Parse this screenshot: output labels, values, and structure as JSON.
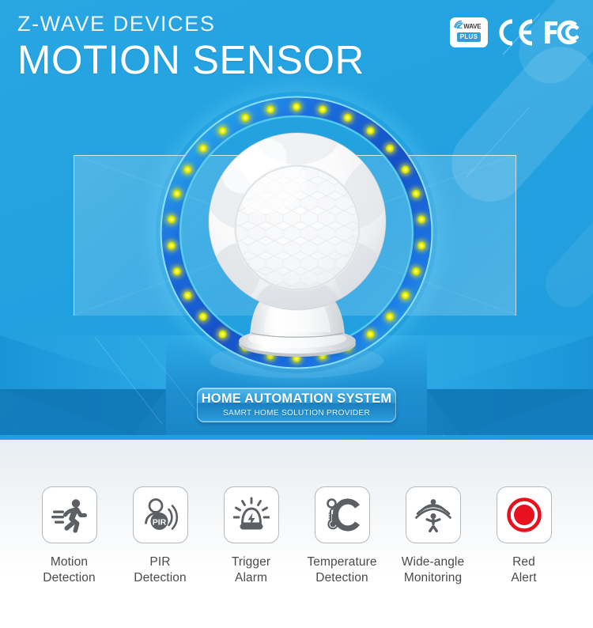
{
  "header": {
    "eyebrow": "Z-WAVE DEVICES",
    "title": "MOTION SENSOR"
  },
  "certifications": {
    "zwave": {
      "mark": "Z",
      "wave": "WAVE",
      "plus": "PLUS",
      "icon": "zwave-plus-badge"
    },
    "ce": {
      "label": "CE",
      "icon": "ce-mark-icon"
    },
    "fcc": {
      "label": "FC",
      "icon": "fcc-mark-icon"
    }
  },
  "product": {
    "name": "motion-sensor-device",
    "description": "white spherical PIR motion sensor with hexagonal fresnel lens on pedestal base",
    "ring": {
      "led_count": 30,
      "led_color": "#e8e81a",
      "band_color": "#1b63d8",
      "edge_color": "#7fe3f5"
    }
  },
  "ribbon": {
    "title": "HOME AUTOMATION SYSTEM",
    "subtitle": "SAMRT HOME SOLUTION PROVIDER"
  },
  "features": [
    {
      "id": "motion-detection",
      "icon": "running-person-icon",
      "label": "Motion\nDetection"
    },
    {
      "id": "pir-detection",
      "icon": "pir-sensor-icon",
      "label": "PIR\nDetection"
    },
    {
      "id": "trigger-alarm",
      "icon": "alarm-siren-icon",
      "label": "Trigger\nAlarm"
    },
    {
      "id": "temperature-detection",
      "icon": "celsius-thermometer-icon",
      "label": "Temperature\nDetection"
    },
    {
      "id": "wide-angle-monitoring",
      "icon": "wide-angle-icon",
      "label": "Wide-angle\nMonitoring"
    },
    {
      "id": "red-alert",
      "icon": "red-alert-icon",
      "label": "Red\nAlert"
    }
  ],
  "colors": {
    "hero_blue": "#23a2e0",
    "stage_blue": "#1a88cf",
    "stage_dark": "#1071b4",
    "icon_gray": "#5c5f63",
    "alert_red": "#e8121f",
    "label_gray": "#4a4a4a"
  }
}
